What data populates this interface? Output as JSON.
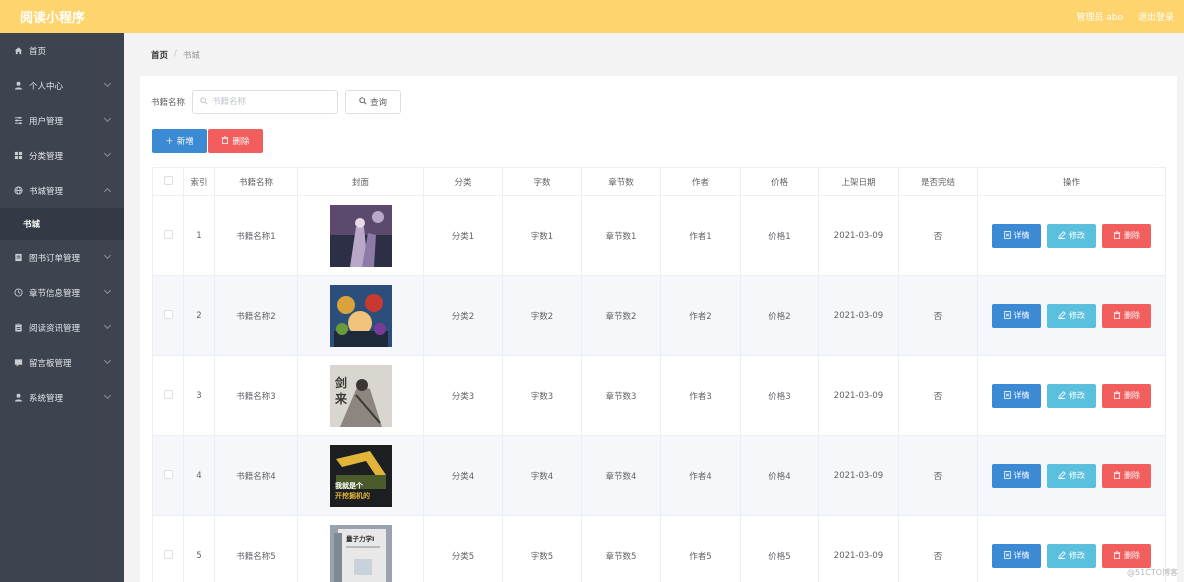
{
  "app": {
    "title": "阅读小程序"
  },
  "header": {
    "admin_label": "管理员 abo",
    "logout_label": "退出登录"
  },
  "sidebar": {
    "items": [
      {
        "label": "首页",
        "icon": "home-icon",
        "has_chevron": false
      },
      {
        "label": "个人中心",
        "icon": "user-icon",
        "has_chevron": true
      },
      {
        "label": "用户管理",
        "icon": "sliders-icon",
        "has_chevron": true
      },
      {
        "label": "分类管理",
        "icon": "grid-icon",
        "has_chevron": true
      },
      {
        "label": "书城管理",
        "icon": "globe-icon",
        "has_chevron": true,
        "expanded": true
      },
      {
        "label": "图书订单管理",
        "icon": "document-icon",
        "has_chevron": true
      },
      {
        "label": "章节信息管理",
        "icon": "clock-icon",
        "has_chevron": true
      },
      {
        "label": "阅读资讯管理",
        "icon": "clipboard-icon",
        "has_chevron": true
      },
      {
        "label": "留言板管理",
        "icon": "message-icon",
        "has_chevron": true
      },
      {
        "label": "系统管理",
        "icon": "user-icon",
        "has_chevron": true
      }
    ],
    "submenu": {
      "label": "书城"
    }
  },
  "breadcrumb": {
    "home": "首页",
    "separator": "/",
    "current": "书城"
  },
  "search": {
    "label": "书籍名称",
    "placeholder": "书籍名称",
    "value": "",
    "query_label": "查询"
  },
  "actions": {
    "add_label": "新增",
    "delete_label": "删除"
  },
  "table": {
    "columns": [
      "索引",
      "书籍名称",
      "封面",
      "分类",
      "字数",
      "章节数",
      "作者",
      "价格",
      "上架日期",
      "是否完结",
      "操作"
    ],
    "op_labels": {
      "detail": "详情",
      "edit": "修改",
      "delete": "删除"
    },
    "rows": [
      {
        "index": "1",
        "name": "书籍名称1",
        "category": "分类1",
        "words": "字数1",
        "chapters": "章节数1",
        "author": "作者1",
        "price": "价格1",
        "date": "2021-03-09",
        "finished": "否",
        "cover_colors": [
          "#5b4a6e",
          "#b9a9c9",
          "#2c2f45"
        ]
      },
      {
        "index": "2",
        "name": "书籍名称2",
        "category": "分类2",
        "words": "字数2",
        "chapters": "章节数2",
        "author": "作者2",
        "price": "价格2",
        "date": "2021-03-09",
        "finished": "否",
        "cover_colors": [
          "#2b4f7a",
          "#d9a23a",
          "#c8392f"
        ]
      },
      {
        "index": "3",
        "name": "书籍名称3",
        "category": "分类3",
        "words": "字数3",
        "chapters": "章节数3",
        "author": "作者3",
        "price": "价格3",
        "date": "2021-03-09",
        "finished": "否",
        "cover_colors": [
          "#d9d6d0",
          "#3a3734",
          "#8c8580"
        ],
        "cover_text": "剑来"
      },
      {
        "index": "4",
        "name": "书籍名称4",
        "category": "分类4",
        "words": "字数4",
        "chapters": "章节数4",
        "author": "作者4",
        "price": "价格4",
        "date": "2021-03-09",
        "finished": "否",
        "cover_colors": [
          "#1c1f22",
          "#e2b53a",
          "#4b5b2c"
        ],
        "cover_text": "我就是个开挖掘机的"
      },
      {
        "index": "5",
        "name": "书籍名称5",
        "category": "分类5",
        "words": "字数5",
        "chapters": "章节数5",
        "author": "作者5",
        "price": "价格5",
        "date": "2021-03-09",
        "finished": "否",
        "cover_colors": [
          "#e8e8e8",
          "#2d2d2d",
          "#9aa3ad"
        ],
        "cover_text": "量子力学Ⅰ"
      }
    ]
  },
  "watermark": "@51CTO博客",
  "colors": {
    "topbar": "#fdd46e",
    "sidebar": "#3d4450",
    "primary": "#3c8ad4",
    "info": "#5bc0de",
    "danger": "#f25d5d"
  }
}
